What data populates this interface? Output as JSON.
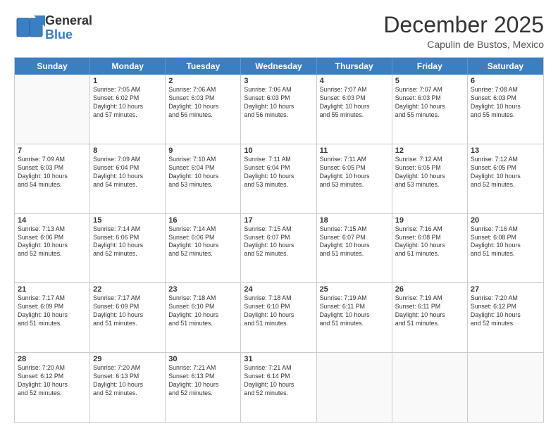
{
  "logo": {
    "general": "General",
    "blue": "Blue"
  },
  "title": "December 2025",
  "location": "Capulin de Bustos, Mexico",
  "days_of_week": [
    "Sunday",
    "Monday",
    "Tuesday",
    "Wednesday",
    "Thursday",
    "Friday",
    "Saturday"
  ],
  "weeks": [
    [
      {
        "day": "",
        "info": ""
      },
      {
        "day": "1",
        "info": "Sunrise: 7:05 AM\nSunset: 6:02 PM\nDaylight: 10 hours\nand 57 minutes."
      },
      {
        "day": "2",
        "info": "Sunrise: 7:06 AM\nSunset: 6:03 PM\nDaylight: 10 hours\nand 56 minutes."
      },
      {
        "day": "3",
        "info": "Sunrise: 7:06 AM\nSunset: 6:03 PM\nDaylight: 10 hours\nand 56 minutes."
      },
      {
        "day": "4",
        "info": "Sunrise: 7:07 AM\nSunset: 6:03 PM\nDaylight: 10 hours\nand 55 minutes."
      },
      {
        "day": "5",
        "info": "Sunrise: 7:07 AM\nSunset: 6:03 PM\nDaylight: 10 hours\nand 55 minutes."
      },
      {
        "day": "6",
        "info": "Sunrise: 7:08 AM\nSunset: 6:03 PM\nDaylight: 10 hours\nand 55 minutes."
      }
    ],
    [
      {
        "day": "7",
        "info": "Sunrise: 7:09 AM\nSunset: 6:03 PM\nDaylight: 10 hours\nand 54 minutes."
      },
      {
        "day": "8",
        "info": "Sunrise: 7:09 AM\nSunset: 6:04 PM\nDaylight: 10 hours\nand 54 minutes."
      },
      {
        "day": "9",
        "info": "Sunrise: 7:10 AM\nSunset: 6:04 PM\nDaylight: 10 hours\nand 53 minutes."
      },
      {
        "day": "10",
        "info": "Sunrise: 7:11 AM\nSunset: 6:04 PM\nDaylight: 10 hours\nand 53 minutes."
      },
      {
        "day": "11",
        "info": "Sunrise: 7:11 AM\nSunset: 6:05 PM\nDaylight: 10 hours\nand 53 minutes."
      },
      {
        "day": "12",
        "info": "Sunrise: 7:12 AM\nSunset: 6:05 PM\nDaylight: 10 hours\nand 53 minutes."
      },
      {
        "day": "13",
        "info": "Sunrise: 7:12 AM\nSunset: 6:05 PM\nDaylight: 10 hours\nand 52 minutes."
      }
    ],
    [
      {
        "day": "14",
        "info": "Sunrise: 7:13 AM\nSunset: 6:06 PM\nDaylight: 10 hours\nand 52 minutes."
      },
      {
        "day": "15",
        "info": "Sunrise: 7:14 AM\nSunset: 6:06 PM\nDaylight: 10 hours\nand 52 minutes."
      },
      {
        "day": "16",
        "info": "Sunrise: 7:14 AM\nSunset: 6:06 PM\nDaylight: 10 hours\nand 52 minutes."
      },
      {
        "day": "17",
        "info": "Sunrise: 7:15 AM\nSunset: 6:07 PM\nDaylight: 10 hours\nand 52 minutes."
      },
      {
        "day": "18",
        "info": "Sunrise: 7:15 AM\nSunset: 6:07 PM\nDaylight: 10 hours\nand 51 minutes."
      },
      {
        "day": "19",
        "info": "Sunrise: 7:16 AM\nSunset: 6:08 PM\nDaylight: 10 hours\nand 51 minutes."
      },
      {
        "day": "20",
        "info": "Sunrise: 7:16 AM\nSunset: 6:08 PM\nDaylight: 10 hours\nand 51 minutes."
      }
    ],
    [
      {
        "day": "21",
        "info": "Sunrise: 7:17 AM\nSunset: 6:09 PM\nDaylight: 10 hours\nand 51 minutes."
      },
      {
        "day": "22",
        "info": "Sunrise: 7:17 AM\nSunset: 6:09 PM\nDaylight: 10 hours\nand 51 minutes."
      },
      {
        "day": "23",
        "info": "Sunrise: 7:18 AM\nSunset: 6:10 PM\nDaylight: 10 hours\nand 51 minutes."
      },
      {
        "day": "24",
        "info": "Sunrise: 7:18 AM\nSunset: 6:10 PM\nDaylight: 10 hours\nand 51 minutes."
      },
      {
        "day": "25",
        "info": "Sunrise: 7:19 AM\nSunset: 6:11 PM\nDaylight: 10 hours\nand 51 minutes."
      },
      {
        "day": "26",
        "info": "Sunrise: 7:19 AM\nSunset: 6:11 PM\nDaylight: 10 hours\nand 51 minutes."
      },
      {
        "day": "27",
        "info": "Sunrise: 7:20 AM\nSunset: 6:12 PM\nDaylight: 10 hours\nand 52 minutes."
      }
    ],
    [
      {
        "day": "28",
        "info": "Sunrise: 7:20 AM\nSunset: 6:12 PM\nDaylight: 10 hours\nand 52 minutes."
      },
      {
        "day": "29",
        "info": "Sunrise: 7:20 AM\nSunset: 6:13 PM\nDaylight: 10 hours\nand 52 minutes."
      },
      {
        "day": "30",
        "info": "Sunrise: 7:21 AM\nSunset: 6:13 PM\nDaylight: 10 hours\nand 52 minutes."
      },
      {
        "day": "31",
        "info": "Sunrise: 7:21 AM\nSunset: 6:14 PM\nDaylight: 10 hours\nand 52 minutes."
      },
      {
        "day": "",
        "info": ""
      },
      {
        "day": "",
        "info": ""
      },
      {
        "day": "",
        "info": ""
      }
    ]
  ]
}
